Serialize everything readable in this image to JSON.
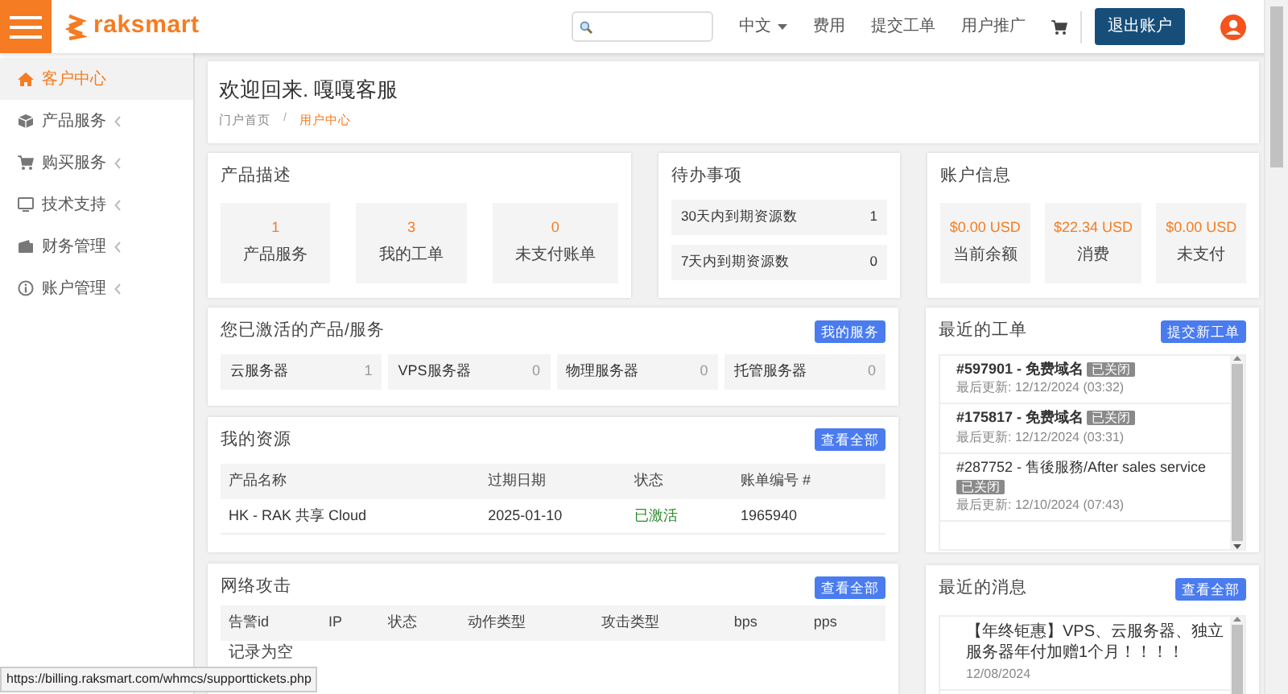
{
  "brand": "raksmart",
  "nav": {
    "language": "中文",
    "links": [
      "费用",
      "提交工单",
      "用户推广"
    ],
    "logout": "退出账户"
  },
  "sidebar": {
    "items": [
      {
        "label": "客户中心",
        "selected": true,
        "has_children": false
      },
      {
        "label": "产品服务",
        "selected": false,
        "has_children": true
      },
      {
        "label": "购买服务",
        "selected": false,
        "has_children": true
      },
      {
        "label": "技术支持",
        "selected": false,
        "has_children": true
      },
      {
        "label": "财务管理",
        "selected": false,
        "has_children": true
      },
      {
        "label": "账户管理",
        "selected": false,
        "has_children": true
      }
    ]
  },
  "welcome": {
    "title": "欢迎回来. 嘎嘎客服",
    "breadcrumb_separator": "/",
    "breadcrumb": [
      {
        "label": "门户首页",
        "selected": false
      },
      {
        "label": "用户中心",
        "selected": true
      }
    ]
  },
  "product_overview": {
    "title": "产品描述",
    "tiles": [
      {
        "value": "1",
        "label": "产品服务"
      },
      {
        "value": "3",
        "label": "我的工单"
      },
      {
        "value": "0",
        "label": "未支付账单"
      }
    ]
  },
  "todo": {
    "title": "待办事项",
    "items": [
      {
        "label": "30天内到期资源数",
        "count": "1"
      },
      {
        "label": "7天内到期资源数",
        "count": "0"
      }
    ]
  },
  "account": {
    "title": "账户信息",
    "tiles": [
      {
        "value": "$0.00 USD",
        "label": "当前余额"
      },
      {
        "value": "$22.34 USD",
        "label": "消费"
      },
      {
        "value": "$0.00 USD",
        "label": "未支付"
      }
    ]
  },
  "active_services": {
    "title": "您已激活的产品/服务",
    "button": "我的服务",
    "items": [
      {
        "label": "云服务器",
        "count": "1"
      },
      {
        "label": "VPS服务器",
        "count": "0"
      },
      {
        "label": "物理服务器",
        "count": "0"
      },
      {
        "label": "托管服务器",
        "count": "0"
      }
    ]
  },
  "resources": {
    "title": "我的资源",
    "button": "查看全部",
    "columns": [
      "产品名称",
      "过期日期",
      "状态",
      "账单编号 #"
    ],
    "rows": [
      {
        "name": "HK - RAK 共享 Cloud",
        "expiry": "2025-01-10",
        "status": "已激活",
        "invoice": "1965940"
      }
    ]
  },
  "attacks": {
    "title": "网络攻击",
    "button": "查看全部",
    "columns": [
      "告警id",
      "IP",
      "状态",
      "动作类型",
      "攻击类型",
      "bps",
      "pps"
    ],
    "empty": "记录为空"
  },
  "tickets": {
    "title": "最近的工单",
    "button": "提交新工单",
    "items": [
      {
        "title": "#597901 - 免费域名",
        "unread": true,
        "status": "已关闭",
        "updated": "最后更新: 12/12/2024 (03:32)"
      },
      {
        "title": "#175817 - 免费域名",
        "unread": true,
        "status": "已关闭",
        "updated": "最后更新: 12/12/2024 (03:31)"
      },
      {
        "title": "#287752 - 售後服務/After sales service",
        "unread": false,
        "status": "已关闭",
        "updated": "最后更新: 12/10/2024 (07:43)"
      }
    ]
  },
  "news": {
    "title": "最近的消息",
    "button": "查看全部",
    "items": [
      {
        "text": "【年终钜惠】VPS、云服务器、独立服务器年付加赠1个月！！！！",
        "date": "12/08/2024"
      }
    ]
  },
  "status_url": "https://billing.raksmart.com/whmcs/supporttickets.php"
}
